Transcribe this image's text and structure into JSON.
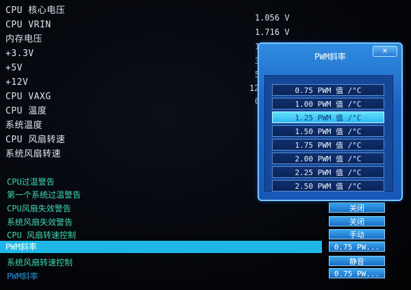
{
  "monitor": [
    {
      "label": "CPU 核心电压",
      "value": "1.056 V"
    },
    {
      "label": "CPU VRIN",
      "value": "1.716 V"
    },
    {
      "label": "内存电压",
      "value": "1"
    },
    {
      "label": "+3.3V",
      "value": "3"
    },
    {
      "label": "+5V",
      "value": "5"
    },
    {
      "label": "+12V",
      "value": "12"
    },
    {
      "label": "CPU VAXG",
      "value": "0"
    },
    {
      "label": "CPU 温度",
      "value": ""
    },
    {
      "label": "系统温度",
      "value": ""
    },
    {
      "label": "CPU 风扇转速",
      "value": ""
    },
    {
      "label": "系统风扇转速",
      "value": ""
    }
  ],
  "settings": [
    {
      "label": "CPU过温警告",
      "value": ""
    },
    {
      "label": "第一个系统过温警告",
      "value": ""
    },
    {
      "label": "CPU风扇失效警告",
      "value": "关闭"
    },
    {
      "label": "系统风扇失效警告",
      "value": "关闭"
    },
    {
      "label": "CPU 风扇转速控制",
      "value": "手动"
    },
    {
      "label": "PWM斜率",
      "value": "0.75 PW..."
    },
    {
      "label": "系统风扇转速控制",
      "value": "静音"
    },
    {
      "label": "PWM斜率",
      "value": "0.75 PW..."
    }
  ],
  "popup": {
    "title": "PWM斜率",
    "close_label": "×",
    "options": [
      "0.75 PWM 值 /°C",
      "1.00 PWM 值 /°C",
      "1.25 PWM 值 /°C",
      "1.50 PWM 值 /°C",
      "1.75 PWM 值 /°C",
      "2.00 PWM 值 /°C",
      "2.25 PWM 值 /°C",
      "2.50 PWM 值 /°C"
    ],
    "active_index": 2
  },
  "colors": {
    "selected_row": "#1fb8e6",
    "menu_text": "#3fd6b0",
    "popup_bg": "#1d63c4"
  }
}
